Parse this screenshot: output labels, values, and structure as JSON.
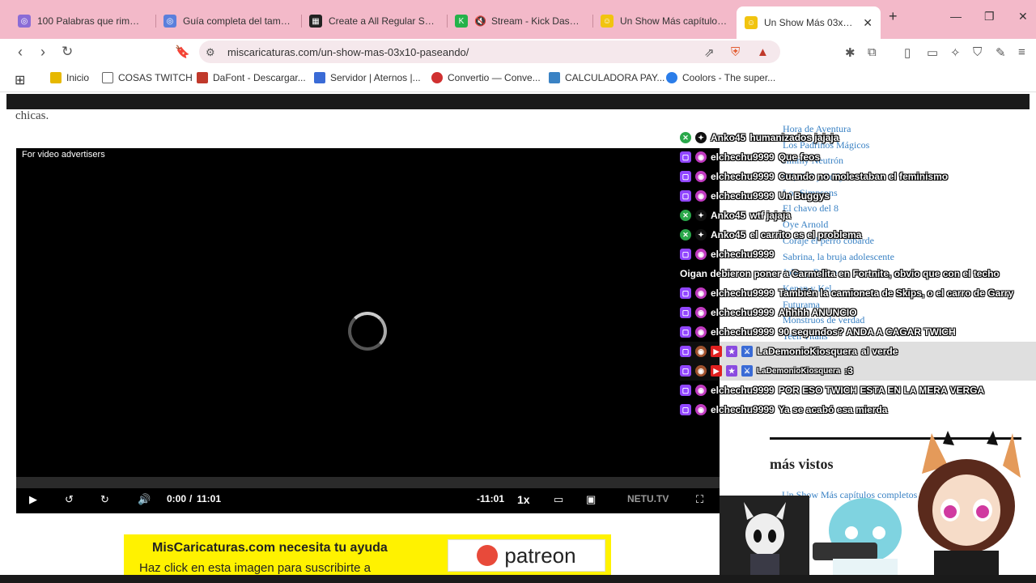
{
  "tabs": [
    {
      "title": "100 Palabras que rimen co",
      "color": "#8a6cd6",
      "glyph": "◎"
    },
    {
      "title": "Guía completa del tamaño",
      "color": "#5b7fdc",
      "glyph": "◎"
    },
    {
      "title": "Create a All Regular Show",
      "color": "#222222",
      "glyph": "▦"
    },
    {
      "title": "Stream - Kick Dashboa",
      "color": "#24b24a",
      "glyph": "K"
    },
    {
      "title": "Un Show Más capítulos co",
      "color": "#f1c40f",
      "glyph": "☺"
    },
    {
      "title": "Un Show Más 03x10 P",
      "color": "#f1c40f",
      "glyph": "☺"
    }
  ],
  "new_tab": "+",
  "address": {
    "url": "miscaricaturas.com/un-show-mas-03x10-paseando/"
  },
  "bookmarks": [
    {
      "label": "Inicio",
      "color": "#e6b800"
    },
    {
      "label": "COSAS TWITCH",
      "color": "#666666"
    },
    {
      "label": "DaFont - Descargar...",
      "color": "#c0392b"
    },
    {
      "label": "Servidor | Aternos |...",
      "color": "#3a6bd6"
    },
    {
      "label": "Convertio — Conve...",
      "color": "#d03030"
    },
    {
      "label": "CALCULADORA PAY...",
      "color": "#3a82c4"
    },
    {
      "label": "Coolors - The super...",
      "color": "#2b7de9"
    }
  ],
  "page": {
    "intro_text": "chicas."
  },
  "video": {
    "ad_label": "For video advertisers",
    "time_current": "0:00",
    "time_sep": "/",
    "time_total": "11:01",
    "time_remaining": "-11:01",
    "speed": "1x",
    "brand": "NETU.TV"
  },
  "sidebar_links": [
    "Hora de Aventura",
    "Los Padrinos Mágicos",
    "Jimmy Neutrón",
    "Ed, Edd y Eddy",
    "Los Simpsons",
    "El chavo del 8",
    "Oye Arnold",
    "Coraje el perro cobarde",
    "Sabrina, la bruja adolescente",
    "Johnny Bravo",
    "Kenan y Kel",
    "Futurama",
    "Monstruos de verdad",
    "Teen Titans"
  ],
  "mas_vistos": {
    "title": "más vistos",
    "link": "Un Show Más capítulos completos"
  },
  "chat": [
    {
      "name": "Anko45",
      "text": "humanizados jajaja",
      "badge": "kick"
    },
    {
      "name": "elchechu9999",
      "text": "Que feos",
      "badge": "twitch"
    },
    {
      "name": "elchechu9999",
      "text": "Cuando no molestaban el feminismo",
      "badge": "twitch"
    },
    {
      "name": "elchechu9999",
      "text": "Un Buggys",
      "badge": "twitch"
    },
    {
      "name": "Anko45",
      "text": "wtf jajaja",
      "badge": "kick"
    },
    {
      "name": "Anko45",
      "text": "el carrito es el problema",
      "badge": "kick"
    },
    {
      "name": "elchechu9999",
      "text": "",
      "badge": "twitch"
    },
    {
      "name": "",
      "text": "Oigan debieron poner a Carmelita en Fortnite, obvio que con el techo",
      "badge": "none"
    },
    {
      "name": "elchechu9999",
      "text": "También la camioneta de Skips, o el carro de Garry",
      "badge": "twitch"
    },
    {
      "name": "elchechu9999",
      "text": "Ahhhh ANUNCIO",
      "badge": "twitch"
    },
    {
      "name": "elchechu9999",
      "text": "90 segundos? ANDA A CAGAR TWICH",
      "badge": "twitch"
    },
    {
      "name": "LaDemonioKiosquera",
      "text": "al verde",
      "badge": "mod"
    },
    {
      "name": "LaDemonioKiosquera",
      "text": ":3",
      "badge": "mod"
    },
    {
      "name": "elchechu9999",
      "text": "POR ESO TWICH ESTA EN LA MERA VERGA",
      "badge": "twitch"
    },
    {
      "name": "elchechu9999",
      "text": "Ya se acabó esa mierda",
      "badge": "twitch"
    }
  ],
  "patreon": {
    "line1": "MisCaricaturas.com necesita tu ayuda",
    "line2": "Haz click en esta imagen para suscribirte a",
    "logo_text": "patreon"
  },
  "colors": {
    "tabbar": "#f3b9c9",
    "twitch": "#9146ff",
    "kick": "#53fc18",
    "patreon_bg": "#fff200"
  }
}
